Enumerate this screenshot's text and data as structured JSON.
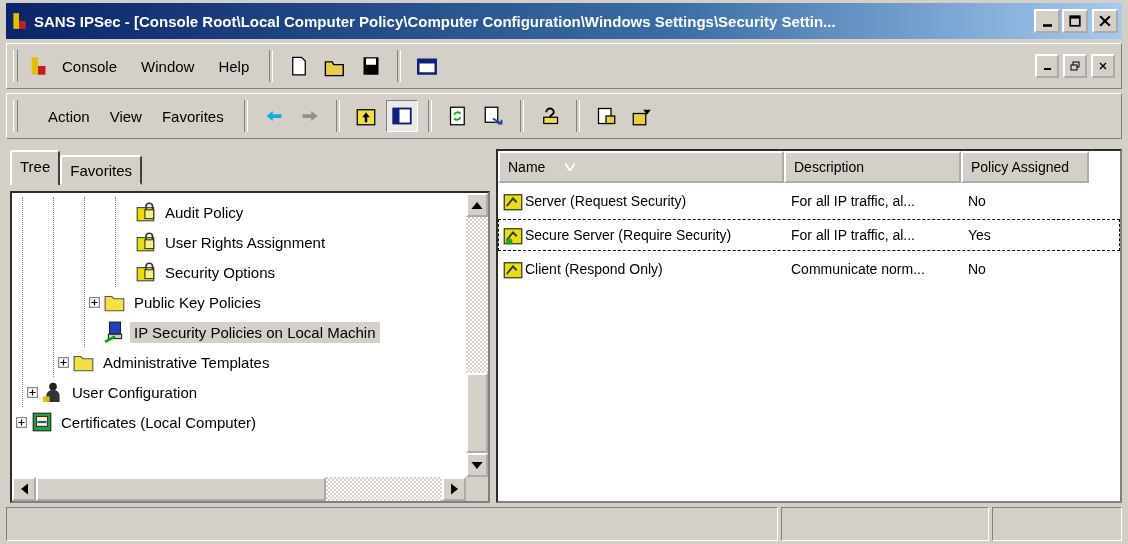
{
  "window": {
    "title": "SANS IPSec - [Console Root\\Local Computer Policy\\Computer Configuration\\Windows Settings\\Security Settin..."
  },
  "menu": [
    {
      "label": "Console"
    },
    {
      "label": "Window"
    },
    {
      "label": "Help"
    }
  ],
  "action_menu": [
    {
      "label": "Action"
    },
    {
      "label": "View"
    },
    {
      "label": "Favorites"
    }
  ],
  "tabs": [
    {
      "label": "Tree",
      "selected": true
    },
    {
      "label": "Favorites",
      "selected": false
    }
  ],
  "tree": [
    {
      "children": [
        {
          "children": [
            {
              "children": [
                {
                  "children": [
                    {
                      "label": "Audit Policy",
                      "kind": "policy",
                      "selected": false
                    },
                    {
                      "label": "User Rights Assignment",
                      "kind": "policy",
                      "selected": false
                    },
                    {
                      "label": "Security Options",
                      "kind": "policy",
                      "selected": false
                    }
                  ]
                },
                {
                  "label": "Public Key Policies",
                  "kind": "folder",
                  "collapsed": true,
                  "selected": false
                },
                {
                  "label": "IP Security Policies on Local Machin",
                  "kind": "ipsec",
                  "selected": true
                }
              ]
            },
            {
              "label": "Administrative Templates",
              "kind": "folder",
              "collapsed": true,
              "selected": false
            }
          ]
        },
        {
          "label": "User Configuration",
          "kind": "user",
          "collapsed": true,
          "selected": false
        }
      ]
    },
    {
      "label": "Certificates (Local Computer)",
      "kind": "certificate",
      "collapsed": true,
      "selected": false
    }
  ],
  "list": {
    "columns": [
      "Name",
      "Description",
      "Policy Assigned"
    ],
    "rows": [
      {
        "name": "Server (Request Security)",
        "description": "For all IP traffic, al...",
        "assigned": "No",
        "focused": false
      },
      {
        "name": "Secure Server (Require Security)",
        "description": "For all IP traffic, al...",
        "assigned": "Yes",
        "focused": true
      },
      {
        "name": "Client (Respond Only)",
        "description": "Communicate norm...",
        "assigned": "No",
        "focused": false
      }
    ]
  }
}
